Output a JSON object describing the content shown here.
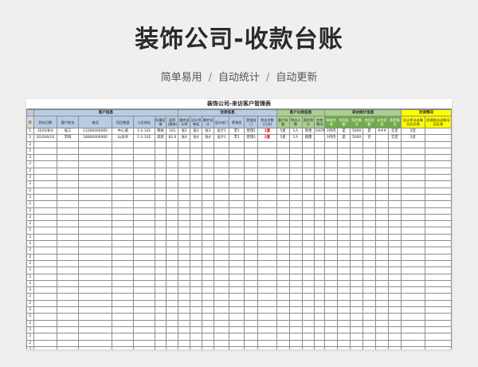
{
  "header": {
    "title": "装饰公司-收款台账",
    "tags": [
      "简单易用",
      "自动统计",
      "自动更新"
    ]
  },
  "sheet": {
    "title": "装饰公司-来访客户管理表",
    "groups": [
      "客户信息",
      "洽谈信息",
      "客户分类信息",
      "来访统计信息",
      "洽谈情况"
    ],
    "columns": [
      "序",
      "到访日期",
      "客户姓名",
      "电话",
      "项目楼盘",
      "小区地址",
      "所属区域",
      "面积(建筑)",
      "量房设计师",
      "设计师电话",
      "量房设计",
      "设计部门",
      "营销员",
      "营销部门",
      "到访次数(几次)",
      "客户质量",
      "到访人数",
      "面积划分",
      "交房情况",
      "装修交成",
      "合同金额",
      "签约情况",
      "合同金额",
      "未交状态",
      "面积情况",
      "设计师洽谈情况及反馈",
      "经理助洽谈情况及反馈"
    ],
    "rows": [
      [
        "1",
        "2020/8/4",
        "张三",
        "13300000000",
        "中心城",
        "1-1-101",
        "郫县",
        "161",
        "张1",
        "张2",
        "张3",
        "设计1",
        "李1",
        "营销1",
        "1套",
        "5星",
        "1人",
        "改善",
        "100平米",
        "3月内",
        "是",
        "5000",
        "是",
        "###",
        "交定",
        "2室",
        "",
        ""
      ],
      [
        "2",
        "2020/8/10",
        "李四",
        "18800000000",
        "山海湾",
        "1-1-102",
        "高新",
        "82.6",
        "张4",
        "张4",
        "张4",
        "设计1",
        "李1",
        "营销1",
        "2套",
        "5星",
        "1人",
        "刚需",
        "",
        "3月内",
        "是",
        "5000",
        "否",
        "",
        "交定",
        "2室",
        "",
        ""
      ]
    ],
    "blank_row_number": "2",
    "blank_row_count": 36
  },
  "colors": {
    "blue": "#b8cce4",
    "grey": "#d9d9d9",
    "green": "#a9d08e",
    "dark_green": "#70ad47",
    "yellow": "#ffff00",
    "visit_count_red": "#e00000"
  }
}
